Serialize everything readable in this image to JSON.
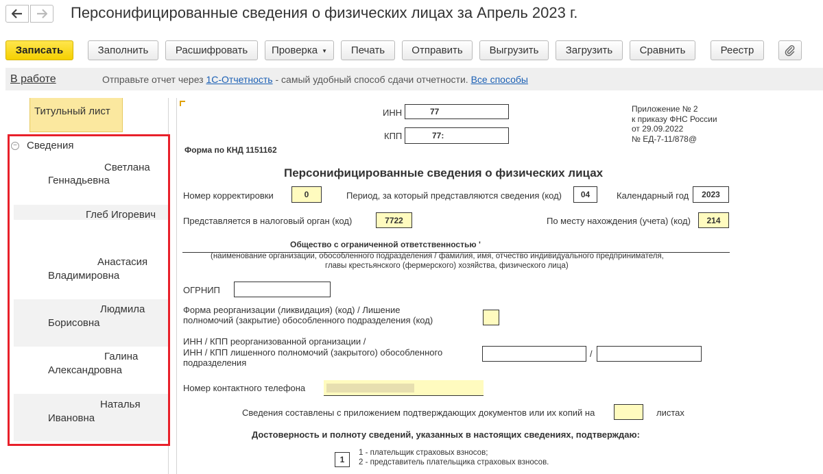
{
  "window": {
    "title": "Персонифицированные сведения о физических лицах за Апрель 2023 г."
  },
  "toolbar": {
    "save": "Записать",
    "fill": "Заполнить",
    "decode": "Расшифровать",
    "check": "Проверка",
    "print": "Печать",
    "send": "Отправить",
    "unload": "Выгрузить",
    "load": "Загрузить",
    "compare": "Сравнить",
    "registry": "Реестр"
  },
  "status": {
    "state": "В работе",
    "msg_prefix": "Отправьте отчет через ",
    "msg_link": "1С-Отчетность",
    "msg_middle": " - самый удобный способ сдачи отчетности. ",
    "msg_link2": "Все способы"
  },
  "left_panel": {
    "title_page": "Титульный лист",
    "group": "Сведения",
    "people": [
      {
        "first": "Светлана",
        "last": "Геннадьевна"
      },
      {
        "first": "Глеб Игоревич",
        "last": ""
      },
      {
        "first": "Анастасия",
        "last": "Владимировна"
      },
      {
        "first": "Людмила",
        "last": "Борисовна"
      },
      {
        "first": "Галина",
        "last": "Александровна"
      },
      {
        "first": "Наталья",
        "last": "Ивановна"
      }
    ]
  },
  "form": {
    "inn_label": "ИНН",
    "inn_value": "77",
    "kpp_label": "КПП",
    "kpp_value": "77:",
    "appendix_1": "Приложение № 2",
    "appendix_2": "к приказу ФНС России",
    "appendix_3": "от 29.09.2022",
    "appendix_4": "№ ЕД-7-11/878@",
    "knd": "Форма по КНД 1151162",
    "title": "Персонифицированные сведения о физических лицах",
    "correction_label": "Номер корректировки",
    "correction_value": "0",
    "period_label": "Период, за который представляются сведения (код)",
    "period_value": "04",
    "year_label": "Календарный год",
    "year_value": "2023",
    "tax_office_label": "Представляется в налоговый орган (код)",
    "tax_office_value": "7722",
    "location_label": "По месту нахождения (учета) (код)",
    "location_value": "214",
    "org_name": "Общество с ограниченной ответственностью '",
    "org_caption_1": "(наименование организации, обособленного подразделения / фамилия, имя, отчество индивидуального предпринимателя,",
    "org_caption_2": "главы крестьянского (фермерского) хозяйства, физического лица)",
    "ogrnip_label": "ОГРНИП",
    "reorg_label_1": "Форма реорганизации (ликвидация) (код) / Лишение",
    "reorg_label_2": "полномочий (закрытие) обособленного подразделения (код)",
    "reorg_inn_1": "ИНН / КПП реорганизованной организации /",
    "reorg_inn_2": "ИНН / КПП лишенного полномочий (закрытого) обособленного",
    "reorg_inn_3": "подразделения",
    "slash": "/",
    "phone_label": "Номер контактного телефона",
    "docs_label": "Сведения составлены с приложением подтверждающих документов или их копий на",
    "docs_suffix": "листах",
    "confirm": "Достоверность и полноту сведений, указанных в настоящих сведениях, подтверждаю:",
    "signer_value": "1",
    "signer_opt_1": "1 - плательщик страховых взносов;",
    "signer_opt_2": "2 - представитель плательщика страховых взносов."
  },
  "colors": {
    "accent_button": "#f5d000",
    "highlight_field": "#fffbbf",
    "selection_frame": "#e8202a",
    "link": "#1a5fb4"
  },
  "icons": [
    "arrow-left-icon",
    "arrow-right-icon",
    "paperclip-icon",
    "collapse-icon"
  ]
}
